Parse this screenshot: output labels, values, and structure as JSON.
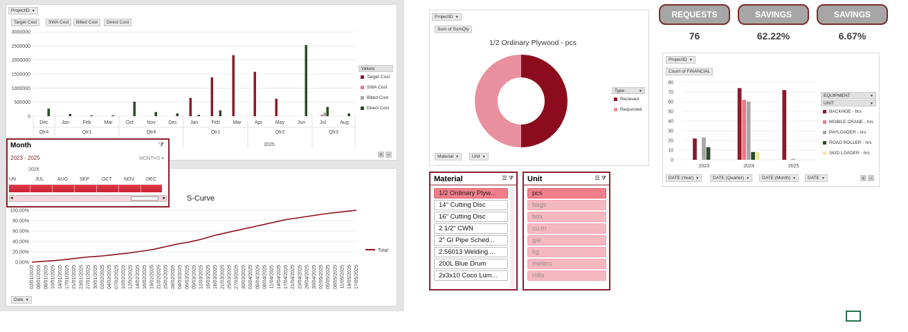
{
  "left_chart": {
    "filter_button": "ProjectID",
    "value_buttons": [
      "Target Cost",
      "SWA Cost",
      "Billed Cost",
      "Direct Cost"
    ],
    "y_ticks": [
      "3000000",
      "2500000",
      "2000000",
      "1500000",
      "1000000",
      "500000",
      "0"
    ],
    "legend_title": "Values",
    "months": [
      "Dec",
      "Jan",
      "Feb",
      "Mar",
      "Oct",
      "Nov",
      "Dec",
      "Jan",
      "Feb",
      "Mar",
      "Apr",
      "May",
      "Jun",
      "Jul",
      "Aug"
    ],
    "quarters": [
      "Qtr4",
      "Qtr1",
      "Qtr4",
      "Qtr1",
      "Qtr2",
      "Qtr3"
    ],
    "year_label": "2025",
    "colors": {
      "target": "#8b1a2a",
      "swa": "#e8798a",
      "billed": "#a6a6a6",
      "direct": "#2d4a2a"
    }
  },
  "month_slicer": {
    "title": "Month",
    "range": "2023 - 2025",
    "level": "MONTHS",
    "year": "2025",
    "months": [
      "JUN",
      "JUL",
      "AUG",
      "SEP",
      "OCT",
      "NOV",
      "DEC"
    ]
  },
  "scurve": {
    "title": "S-Curve",
    "y_ticks": [
      "100.00%",
      "80.00%",
      "60.00%",
      "40.00%",
      "20.00%",
      "0.00%"
    ],
    "legend": "Total",
    "date_button": "Date",
    "dates": [
      "02/01/2025",
      "06/01/2025",
      "08/01/2025",
      "10/01/2025",
      "14/01/2025",
      "17/01/2025",
      "21/01/2025",
      "23/01/2025",
      "27/01/2025",
      "30/01/2025",
      "02/02/2025",
      "04/02/2025",
      "07/02/2025",
      "10/02/2025",
      "12/02/2025",
      "14/02/2025",
      "16/02/2025",
      "19/02/2025",
      "21/02/2025",
      "25/02/2025",
      "28/02/2025",
      "04/03/2025",
      "06/03/2025",
      "09/03/2025",
      "12/03/2025",
      "16/03/2025",
      "18/03/2025",
      "21/03/2025",
      "25/03/2025",
      "27/03/2025",
      "30/03/2025",
      "03/04/2025",
      "06/04/2025",
      "08/04/2025",
      "11/04/2025",
      "14/04/2025",
      "17/04/2025",
      "21/04/2025",
      "23/04/2025",
      "26/04/2025",
      "30/04/2025",
      "02/05/2025",
      "05/05/2025",
      "08/05/2025",
      "11/05/2025",
      "14/05/2025",
      "17/05/2025"
    ]
  },
  "chart_data": [
    {
      "type": "bar",
      "title": "",
      "categories": [
        "Dec",
        "Jan",
        "Feb",
        "Mar",
        "Oct",
        "Nov",
        "Dec",
        "Jan",
        "Feb",
        "Mar",
        "Apr",
        "May",
        "Jun",
        "Jul",
        "Aug"
      ],
      "series": [
        {
          "name": "Target Cost",
          "values": [
            0,
            0,
            0,
            0,
            0,
            0,
            0,
            650000,
            1380000,
            2170000,
            1580000,
            620000,
            0,
            0,
            0
          ]
        },
        {
          "name": "SWA Cost",
          "values": [
            0,
            0,
            0,
            0,
            0,
            0,
            0,
            0,
            0,
            0,
            0,
            0,
            0,
            60000,
            0
          ]
        },
        {
          "name": "Billed Cost",
          "values": [
            0,
            0,
            0,
            0,
            0,
            0,
            0,
            0,
            0,
            0,
            0,
            0,
            0,
            130000,
            0
          ]
        },
        {
          "name": "Direct Cost",
          "values": [
            270000,
            80000,
            30000,
            30000,
            520000,
            150000,
            100000,
            50000,
            210000,
            0,
            0,
            0,
            2530000,
            330000,
            100000
          ]
        }
      ],
      "ylim": [
        0,
        3000000
      ],
      "legend": "right"
    },
    {
      "type": "line",
      "title": "S-Curve",
      "series": [
        {
          "name": "Total",
          "values": [
            0,
            1,
            2,
            3,
            4,
            5.5,
            7,
            8.5,
            10,
            11,
            12,
            13.5,
            15,
            16.5,
            18,
            20,
            22,
            24,
            27,
            30,
            33,
            36,
            38,
            41,
            44,
            48,
            52,
            55,
            58,
            61,
            64,
            67,
            70,
            73,
            76,
            79,
            82,
            84,
            86,
            88,
            90,
            92,
            94,
            95.5,
            97,
            98.5,
            100
          ]
        }
      ],
      "ylim": [
        0,
        100
      ],
      "legend": "right"
    },
    {
      "type": "pie",
      "title": "1/2 Ordinary Plywood - pcs",
      "categories": [
        "Recieved",
        "Requested"
      ],
      "values": [
        50,
        50
      ],
      "legend": "right"
    },
    {
      "type": "bar",
      "title": "",
      "categories": [
        "2023",
        "2024",
        "2025"
      ],
      "series": [
        {
          "name": "BACKHOE - hrs",
          "values": [
            22,
            74,
            72
          ]
        },
        {
          "name": "MOBILE CRANE - hrs",
          "values": [
            0,
            62,
            0
          ]
        },
        {
          "name": "PAYLOADER - hrs",
          "values": [
            23,
            60,
            1
          ]
        },
        {
          "name": "ROAD ROLLER - hrs",
          "values": [
            13,
            8,
            0
          ]
        },
        {
          "name": "SKID LOADER - hrs",
          "values": [
            0,
            8,
            0
          ]
        }
      ],
      "ylim": [
        0,
        80
      ],
      "legend": "right"
    }
  ],
  "donut": {
    "filter_button": "ProjectID",
    "value_button": "Sum of SumQty",
    "legend_title": "Type",
    "legend": [
      "Recieved",
      "Requested"
    ],
    "buttons": [
      "Material",
      "Unit"
    ],
    "colors": {
      "received": "#8b0d1d",
      "requested": "#e9909e"
    }
  },
  "kpis": [
    {
      "label": "REQUESTS",
      "value": "76"
    },
    {
      "label": "SAVINGS",
      "value": "62.22%"
    },
    {
      "label": "SAVINGS",
      "value": "6.67%"
    }
  ],
  "equipment_chart": {
    "filter_button": "ProjectID",
    "value_button": "Count of FINANCIAL",
    "y_ticks": [
      "80",
      "70",
      "60",
      "50",
      "40",
      "30",
      "20",
      "10",
      "0"
    ],
    "x_labels": [
      "2023",
      "2024",
      "2025"
    ],
    "legend_headers": [
      "EQUIPMENT",
      "UNIT"
    ],
    "legend": [
      "BACKHOE - hrs",
      "MOBILE CRANE - hrs",
      "PAYLOADER - hrs",
      "ROAD ROLLER - hrs",
      "SKID LOADER - hrs"
    ],
    "date_buttons": [
      "DATE (Year)",
      "DATE (Quarter)",
      "DATE (Month)",
      "DATE"
    ],
    "colors": [
      "#8b1a2a",
      "#e8798a",
      "#a6a6a6",
      "#2d4a2a",
      "#f2e8a0"
    ]
  },
  "material_slicer": {
    "title": "Material",
    "items": [
      "1/2 Ordinary Plyw...",
      "14\" Cutting Disc",
      "16\" Cutting Disc",
      "2 1/2\" CWN",
      "2\" GI Pipe Sched...",
      "2.56013 Welding ...",
      "200L Blue Drum",
      "2x3x10 Coco Lum..."
    ]
  },
  "unit_slicer": {
    "title": "Unit",
    "items": [
      "pcs",
      "bags",
      "box",
      "cu.m",
      "gal",
      "kg",
      "meters",
      "rolls"
    ]
  }
}
